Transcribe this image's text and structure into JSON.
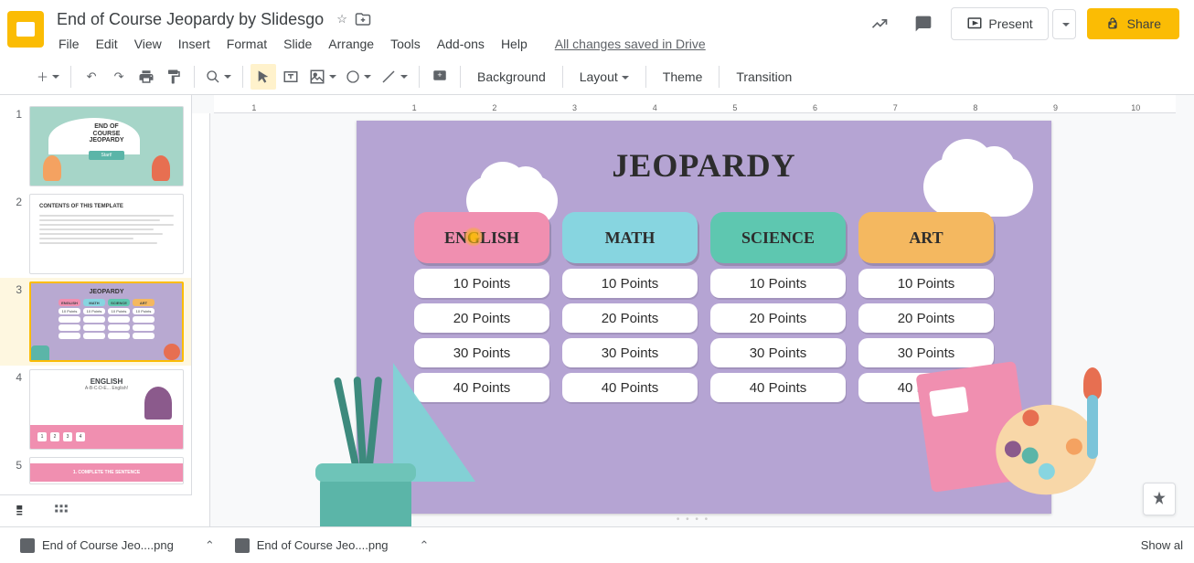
{
  "header": {
    "title": "End of Course Jeopardy by Slidesgo",
    "saved": "All changes saved in Drive",
    "menu": [
      "File",
      "Edit",
      "View",
      "Insert",
      "Format",
      "Slide",
      "Arrange",
      "Tools",
      "Add-ons",
      "Help"
    ],
    "present": "Present",
    "share": "Share"
  },
  "toolbar": {
    "background": "Background",
    "layout": "Layout",
    "theme": "Theme",
    "transition": "Transition"
  },
  "thumbs": {
    "t1_l1": "END OF",
    "t1_l2": "COURSE",
    "t1_l3": "JEOPARDY",
    "t1_btn": "Start!",
    "t2_title": "CONTENTS OF THIS TEMPLATE",
    "t3_title": "JEOPARDY",
    "t3_cats": [
      "ENGLISH",
      "MATH",
      "SCIENCE",
      "ART"
    ],
    "t3_pt": "10 Points",
    "t4_title": "ENGLISH",
    "t4_sub": "A-B-C-D-E... English!",
    "t4_nums": [
      "1",
      "2",
      "3",
      "4"
    ],
    "t5_title": "1. COMPLETE THE SENTENCE"
  },
  "slide": {
    "title": "JEOPARDY",
    "categories": [
      {
        "name": "ENGLISH",
        "cls": "cat-english"
      },
      {
        "name": "MATH",
        "cls": "cat-math"
      },
      {
        "name": "SCIENCE",
        "cls": "cat-science"
      },
      {
        "name": "ART",
        "cls": "cat-art"
      }
    ],
    "points": [
      "10 Points",
      "20 Points",
      "30 Points",
      "40 Points"
    ]
  },
  "ruler": [
    "1",
    "",
    "1",
    "2",
    "3",
    "4",
    "5",
    "6",
    "7",
    "8",
    "9",
    "10"
  ],
  "bottom": {
    "file1": "End of Course Jeo....png",
    "file2": "End of Course Jeo....png",
    "showall": "Show al"
  }
}
